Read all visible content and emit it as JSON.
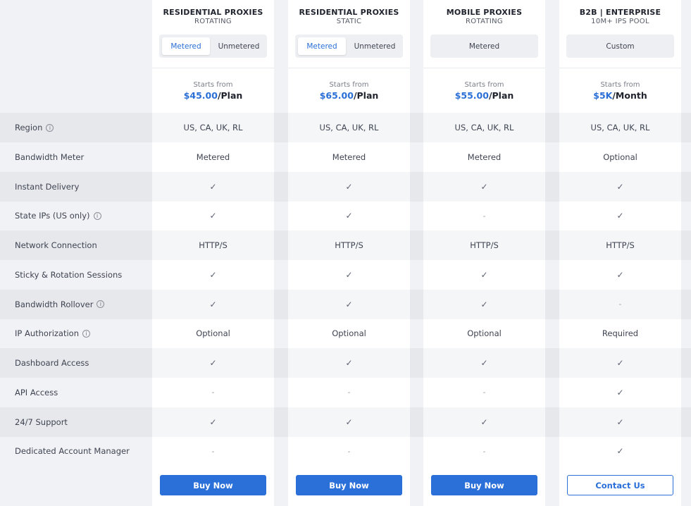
{
  "features": [
    {
      "label": "Region",
      "info": true
    },
    {
      "label": "Bandwidth Meter",
      "info": false
    },
    {
      "label": "Instant Delivery",
      "info": false
    },
    {
      "label": "State IPs (US only)",
      "info": true
    },
    {
      "label": "Network Connection",
      "info": false
    },
    {
      "label": "Sticky & Rotation Sessions",
      "info": false
    },
    {
      "label": "Bandwidth Rollover",
      "info": true
    },
    {
      "label": "IP Authorization",
      "info": true
    },
    {
      "label": "Dashboard Access",
      "info": false
    },
    {
      "label": "API Access",
      "info": false
    },
    {
      "label": "24/7 Support",
      "info": false
    },
    {
      "label": "Dedicated Account Manager",
      "info": false
    }
  ],
  "info_glyph": "ⓘ",
  "check_glyph": "✓",
  "dash_glyph": "-",
  "colors": {
    "accent": "#2b6fd9",
    "price": "#2a6fd6"
  },
  "plans": [
    {
      "title": "RESIDENTIAL PROXIES",
      "subtitle": "ROTATING",
      "toggle": [
        "Metered",
        "Unmetered"
      ],
      "active_toggle": 0,
      "starts_from": "Starts from",
      "price": "$45.00",
      "price_unit": "/Plan",
      "values": [
        "US, CA, UK, RL",
        "Metered",
        "check",
        "check",
        "HTTP/S",
        "check",
        "check",
        "Optional",
        "check",
        "dash",
        "check",
        "dash"
      ],
      "button": "Buy Now",
      "button_style": "primary"
    },
    {
      "title": "RESIDENTIAL PROXIES",
      "subtitle": "STATIC",
      "toggle": [
        "Metered",
        "Unmetered"
      ],
      "active_toggle": 0,
      "starts_from": "Starts from",
      "price": "$65.00",
      "price_unit": "/Plan",
      "values": [
        "US, CA, UK, RL",
        "Metered",
        "check",
        "check",
        "HTTP/S",
        "check",
        "check",
        "Optional",
        "check",
        "dash",
        "check",
        "dash"
      ],
      "button": "Buy Now",
      "button_style": "primary"
    },
    {
      "title": "MOBILE PROXIES",
      "subtitle": "ROTATING",
      "toggle": [
        "Metered"
      ],
      "active_toggle": -1,
      "starts_from": "Starts from",
      "price": "$55.00",
      "price_unit": "/Plan",
      "values": [
        "US, CA, UK, RL",
        "Metered",
        "check",
        "dash",
        "HTTP/S",
        "check",
        "check",
        "Optional",
        "check",
        "dash",
        "check",
        "dash"
      ],
      "button": "Buy Now",
      "button_style": "primary"
    },
    {
      "title": "B2B | ENTERPRISE",
      "subtitle": "10M+ IPS POOL",
      "toggle": [
        "Custom"
      ],
      "active_toggle": -1,
      "starts_from": "Starts from",
      "price": "$5K",
      "price_unit": "/Month",
      "values": [
        "US, CA, UK, RL",
        "Optional",
        "check",
        "check",
        "HTTP/S",
        "check",
        "dash",
        "Required",
        "check",
        "check",
        "check",
        "check"
      ],
      "button": "Contact Us",
      "button_style": "outline"
    }
  ]
}
